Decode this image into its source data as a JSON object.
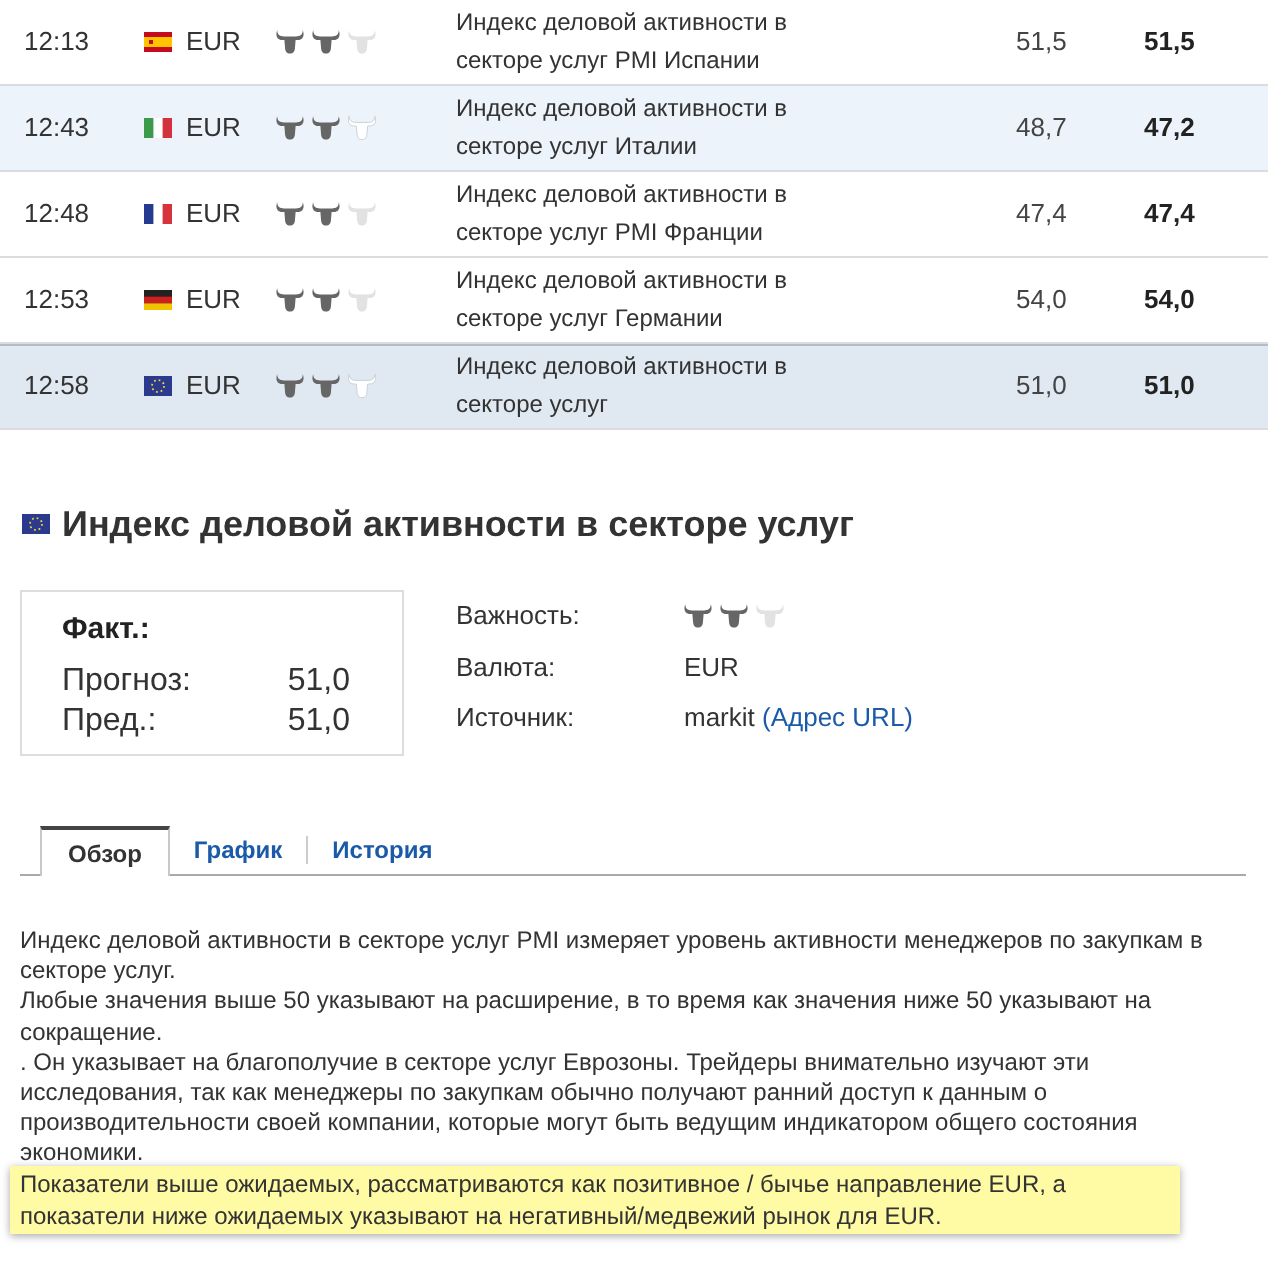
{
  "events": [
    {
      "time": "12:13",
      "flag": {
        "kind": "spain"
      },
      "currency": "EUR",
      "stars": 2,
      "event": "Индекс деловой активности в секторе услуг PMI Испании",
      "column_5": "51,5",
      "column_6": "51,5",
      "hovered": false,
      "selected": false
    },
    {
      "time": "12:43",
      "flag": {
        "kind": "italy"
      },
      "currency": "EUR",
      "stars": 2,
      "event": "Индекс деловой активности в секторе услуг Италии",
      "column_5": "48,7",
      "column_6": "47,2",
      "hovered": true,
      "selected": false
    },
    {
      "time": "12:48",
      "flag": {
        "kind": "france"
      },
      "currency": "EUR",
      "stars": 2,
      "event": "Индекс деловой активности в секторе услуг PMI Франции",
      "column_5": "47,4",
      "column_6": "47,4",
      "hovered": false,
      "selected": false
    },
    {
      "time": "12:53",
      "flag": {
        "kind": "germany"
      },
      "currency": "EUR",
      "stars": 2,
      "event": "Индекс деловой активности в секторе услуг Германии",
      "column_5": "54,0",
      "column_6": "54,0",
      "hovered": false,
      "selected": false
    },
    {
      "time": "12:58",
      "flag": {
        "kind": "eu"
      },
      "currency": "EUR",
      "stars": 2,
      "event": "Индекс деловой активности в секторе услуг",
      "column_5": "51,0",
      "column_6": "51,0",
      "hovered": false,
      "selected": true
    }
  ],
  "detail": {
    "flag": {
      "kind": "eu"
    },
    "title": "Индекс деловой активности в секторе услуг",
    "actual_label": "Факт.:",
    "forecast_label": "Прогноз:",
    "forecast": "51,0",
    "previous_label": "Пред.:",
    "previous": "51,0",
    "info": [
      {
        "kind": "stars",
        "label": "Важность:",
        "stars": 2
      },
      {
        "kind": "text",
        "label": "Валюта:",
        "value": "EUR"
      },
      {
        "kind": "source",
        "label": "Источник:",
        "value": "markit",
        "link": "(Адрес URL)"
      }
    ]
  },
  "tabs": [
    {
      "label": "Обзор",
      "selected": true
    },
    {
      "label": "График",
      "selected": false
    },
    {
      "label": "История",
      "selected": false
    }
  ],
  "description": [
    "Индекс деловой активности в секторе услуг PMI измеряет уровень активности менеджеров по закупкам в секторе услуг.",
    "Любые значения выше 50 указывают на расширение, в то время как значения ниже 50 указывают на сокращение.",
    ". Он указывает на благополучие в секторе услуг Еврозоны. Трейдеры внимательно изучают эти исследования, так как менеджеры по закупкам обычно получают ранний доступ к данным о производительности своей компании, которые могут быть ведущим индикатором общего состояния экономики."
  ],
  "note": "Показатели выше ожидаемых, рассматриваются как позитивное / бычье направление EUR, а показатели ниже ожидаемых указывают на негативный/медвежий рынок для EUR."
}
